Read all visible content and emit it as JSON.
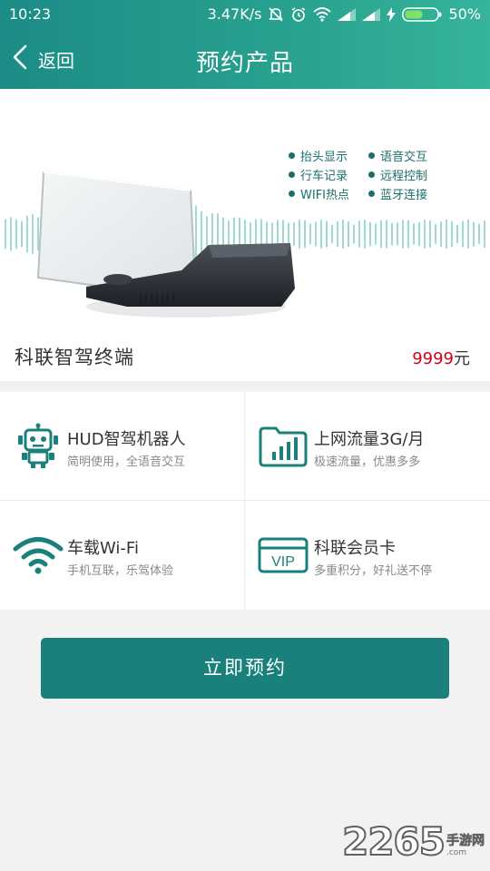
{
  "status_bar": {
    "time": "10:23",
    "network_speed": "3.47K/s",
    "battery": "50%"
  },
  "nav": {
    "back_label": "返回",
    "title": "预约产品"
  },
  "banner": {
    "features": [
      "抬头显示",
      "语音交互",
      "行车记录",
      "远程控制",
      "WIFI热点",
      "蓝牙连接"
    ]
  },
  "product": {
    "name": "科联智驾终端",
    "price_value": "9999",
    "price_unit": "元"
  },
  "benefits": [
    {
      "title": "HUD智驾机器人",
      "subtitle": "简明使用，全语音交互",
      "icon": "robot-icon"
    },
    {
      "title": "上网流量3G/月",
      "subtitle": "极速流量，优惠多多",
      "icon": "data-chart-icon"
    },
    {
      "title": "车载Wi-Fi",
      "subtitle": "手机互联，乐驾体验",
      "icon": "wifi-icon"
    },
    {
      "title": "科联会员卡",
      "subtitle": "多重积分，好礼送不停",
      "icon": "vip-card-icon"
    }
  ],
  "vip_card_text": "VIP",
  "reserve_button": "立即预约",
  "watermark": {
    "number": "2265",
    "text": "手游网",
    "url": ".com"
  },
  "colors": {
    "header_start": "#1c8c86",
    "header_end": "#36b49a",
    "accent": "#1a807b",
    "price": "#d0021b"
  }
}
